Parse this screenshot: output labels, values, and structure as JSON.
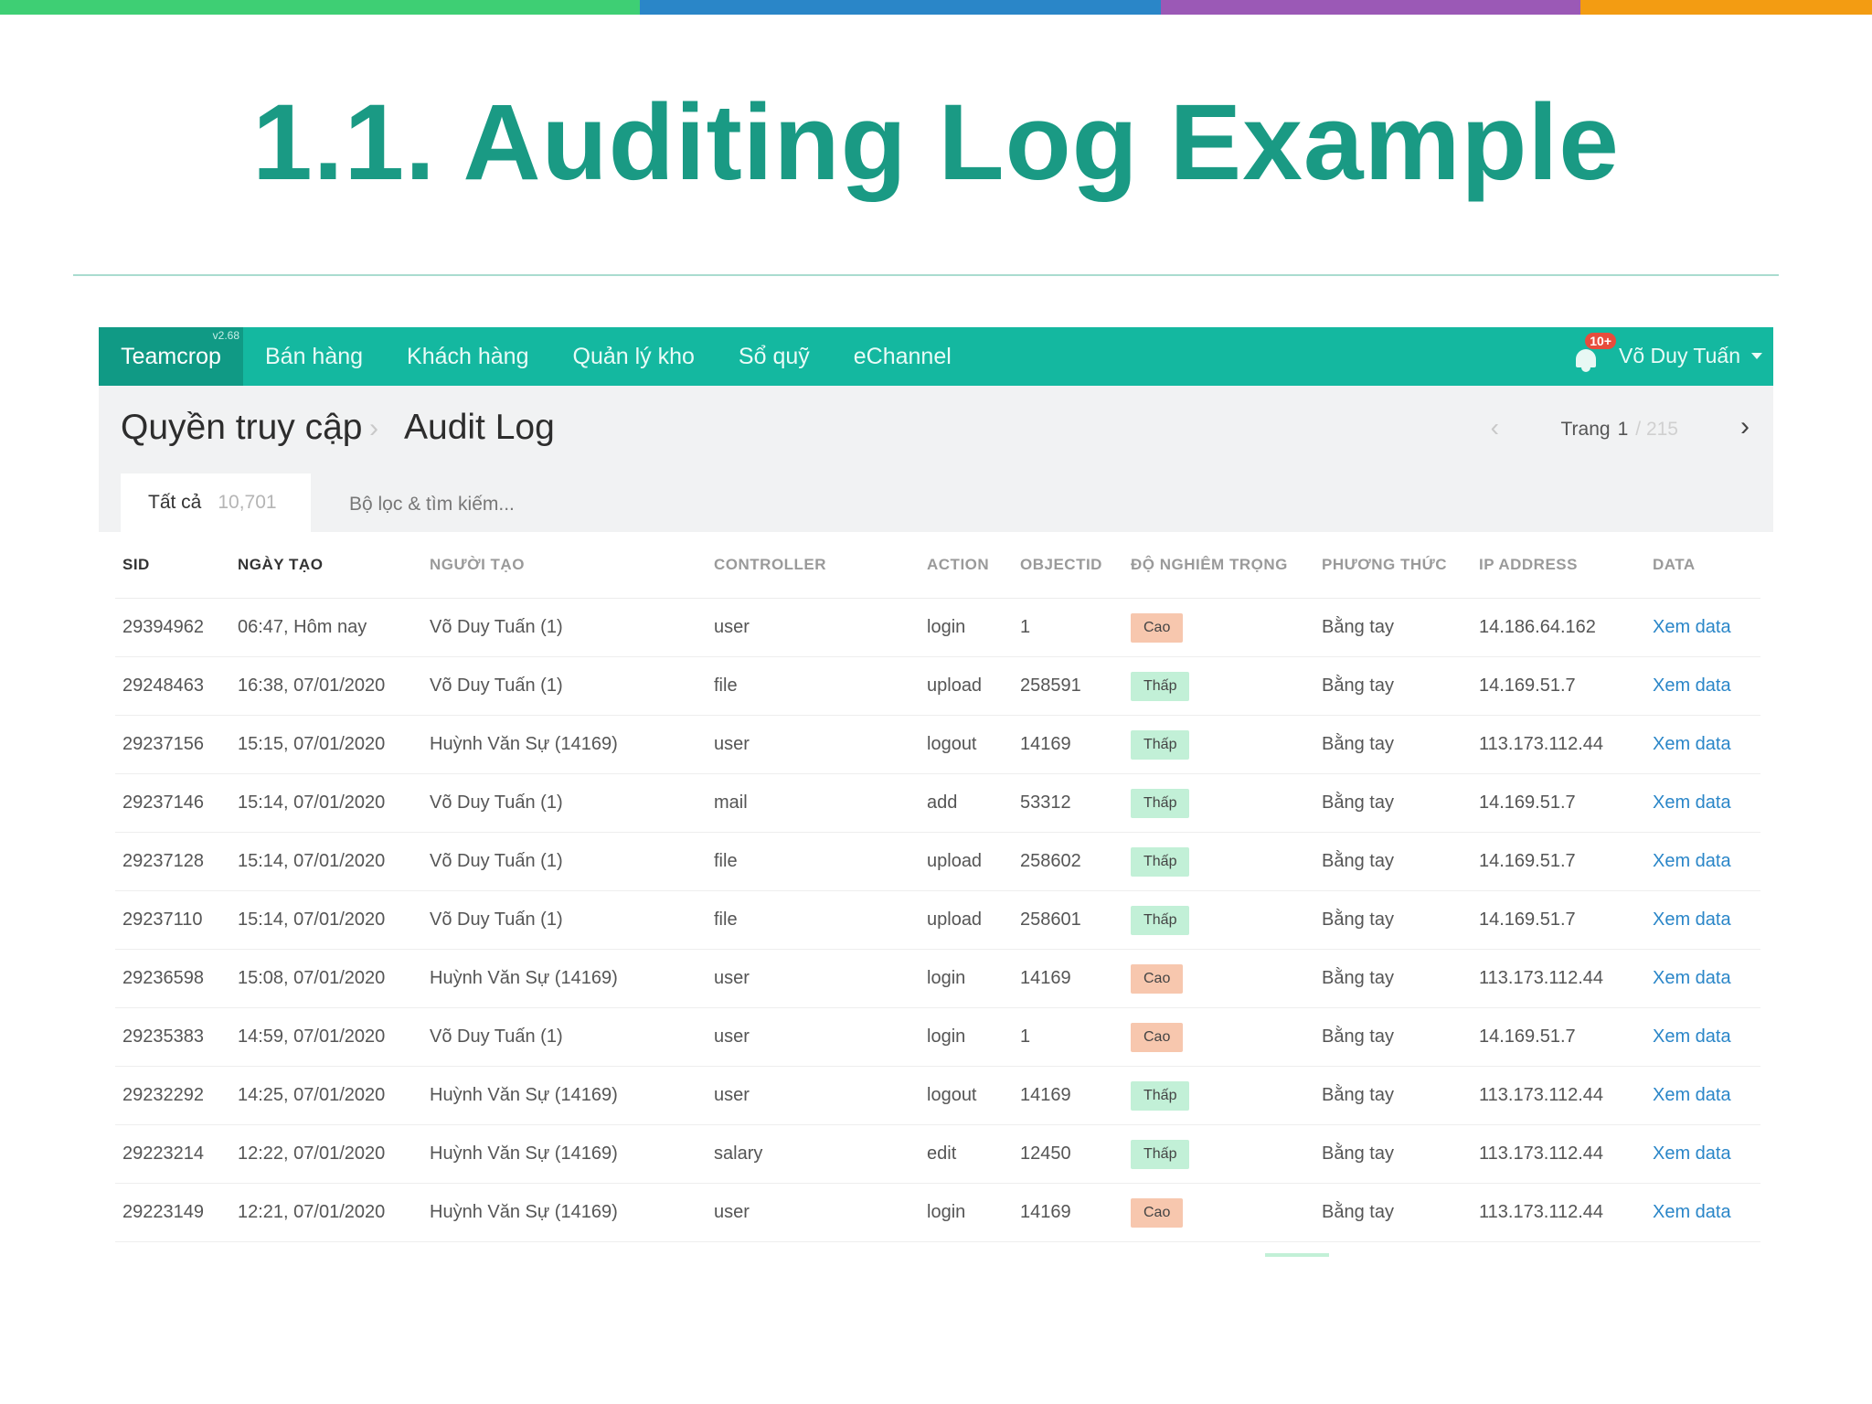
{
  "slide": {
    "title": "1.1. Auditing Log Example",
    "stripe_colors": [
      "#3ecf74",
      "#2a86c8",
      "#9b59b6",
      "#f39c12"
    ],
    "accent": "#1a9a84"
  },
  "nav": {
    "brand": "Teamcrop",
    "version": "v2.68",
    "items": [
      "Bán hàng",
      "Khách hàng",
      "Quản lý kho",
      "Sổ quỹ",
      "eChannel"
    ],
    "notification_badge": "10+",
    "user": "Võ Duy Tuấn",
    "color": "#14b8a0"
  },
  "header": {
    "breadcrumb_parent": "Quyền truy cập",
    "breadcrumb_current": "Audit Log",
    "pagination": {
      "label": "Trang",
      "current": "1",
      "total": "/ 215"
    }
  },
  "tabs": {
    "all_label": "Tất cả",
    "all_count": "10,701",
    "filter_label": "Bộ lọc & tìm kiếm..."
  },
  "table": {
    "columns": [
      "SID",
      "NGÀY TẠO",
      "NGƯỜI TẠO",
      "CONTROLLER",
      "ACTION",
      "OBJECTID",
      "ĐỘ NGHIÊM TRỌNG",
      "PHƯƠNG THỨC",
      "IP ADDRESS",
      "DATA"
    ],
    "rows": [
      {
        "sid": "29394962",
        "date": "06:47, Hôm nay",
        "creator": "Võ Duy Tuấn (1)",
        "controller": "user",
        "action": "login",
        "objectid": "1",
        "severity": "Cao",
        "severity_level": "high",
        "method": "Bằng tay",
        "ip": "14.186.64.162",
        "data": "Xem data"
      },
      {
        "sid": "29248463",
        "date": "16:38, 07/01/2020",
        "creator": "Võ Duy Tuấn (1)",
        "controller": "file",
        "action": "upload",
        "objectid": "258591",
        "severity": "Thấp",
        "severity_level": "low",
        "method": "Bằng tay",
        "ip": "14.169.51.7",
        "data": "Xem data"
      },
      {
        "sid": "29237156",
        "date": "15:15, 07/01/2020",
        "creator": "Huỳnh Văn Sự (14169)",
        "controller": "user",
        "action": "logout",
        "objectid": "14169",
        "severity": "Thấp",
        "severity_level": "low",
        "method": "Bằng tay",
        "ip": "113.173.112.44",
        "data": "Xem data"
      },
      {
        "sid": "29237146",
        "date": "15:14, 07/01/2020",
        "creator": "Võ Duy Tuấn (1)",
        "controller": "mail",
        "action": "add",
        "objectid": "53312",
        "severity": "Thấp",
        "severity_level": "low",
        "method": "Bằng tay",
        "ip": "14.169.51.7",
        "data": "Xem data"
      },
      {
        "sid": "29237128",
        "date": "15:14, 07/01/2020",
        "creator": "Võ Duy Tuấn (1)",
        "controller": "file",
        "action": "upload",
        "objectid": "258602",
        "severity": "Thấp",
        "severity_level": "low",
        "method": "Bằng tay",
        "ip": "14.169.51.7",
        "data": "Xem data"
      },
      {
        "sid": "29237110",
        "date": "15:14, 07/01/2020",
        "creator": "Võ Duy Tuấn (1)",
        "controller": "file",
        "action": "upload",
        "objectid": "258601",
        "severity": "Thấp",
        "severity_level": "low",
        "method": "Bằng tay",
        "ip": "14.169.51.7",
        "data": "Xem data"
      },
      {
        "sid": "29236598",
        "date": "15:08, 07/01/2020",
        "creator": "Huỳnh Văn Sự (14169)",
        "controller": "user",
        "action": "login",
        "objectid": "14169",
        "severity": "Cao",
        "severity_level": "high",
        "method": "Bằng tay",
        "ip": "113.173.112.44",
        "data": "Xem data"
      },
      {
        "sid": "29235383",
        "date": "14:59, 07/01/2020",
        "creator": "Võ Duy Tuấn (1)",
        "controller": "user",
        "action": "login",
        "objectid": "1",
        "severity": "Cao",
        "severity_level": "high",
        "method": "Bằng tay",
        "ip": "14.169.51.7",
        "data": "Xem data"
      },
      {
        "sid": "29232292",
        "date": "14:25, 07/01/2020",
        "creator": "Huỳnh Văn Sự (14169)",
        "controller": "user",
        "action": "logout",
        "objectid": "14169",
        "severity": "Thấp",
        "severity_level": "low",
        "method": "Bằng tay",
        "ip": "113.173.112.44",
        "data": "Xem data"
      },
      {
        "sid": "29223214",
        "date": "12:22, 07/01/2020",
        "creator": "Huỳnh Văn Sự (14169)",
        "controller": "salary",
        "action": "edit",
        "objectid": "12450",
        "severity": "Thấp",
        "severity_level": "low",
        "method": "Bằng tay",
        "ip": "113.173.112.44",
        "data": "Xem data"
      },
      {
        "sid": "29223149",
        "date": "12:21, 07/01/2020",
        "creator": "Huỳnh Văn Sự (14169)",
        "controller": "user",
        "action": "login",
        "objectid": "14169",
        "severity": "Cao",
        "severity_level": "high",
        "method": "Bằng tay",
        "ip": "113.173.112.44",
        "data": "Xem data"
      }
    ],
    "severity_colors": {
      "high": "#f7c7ae",
      "low": "#c2f0d7"
    },
    "link_color": "#2a86c8"
  }
}
